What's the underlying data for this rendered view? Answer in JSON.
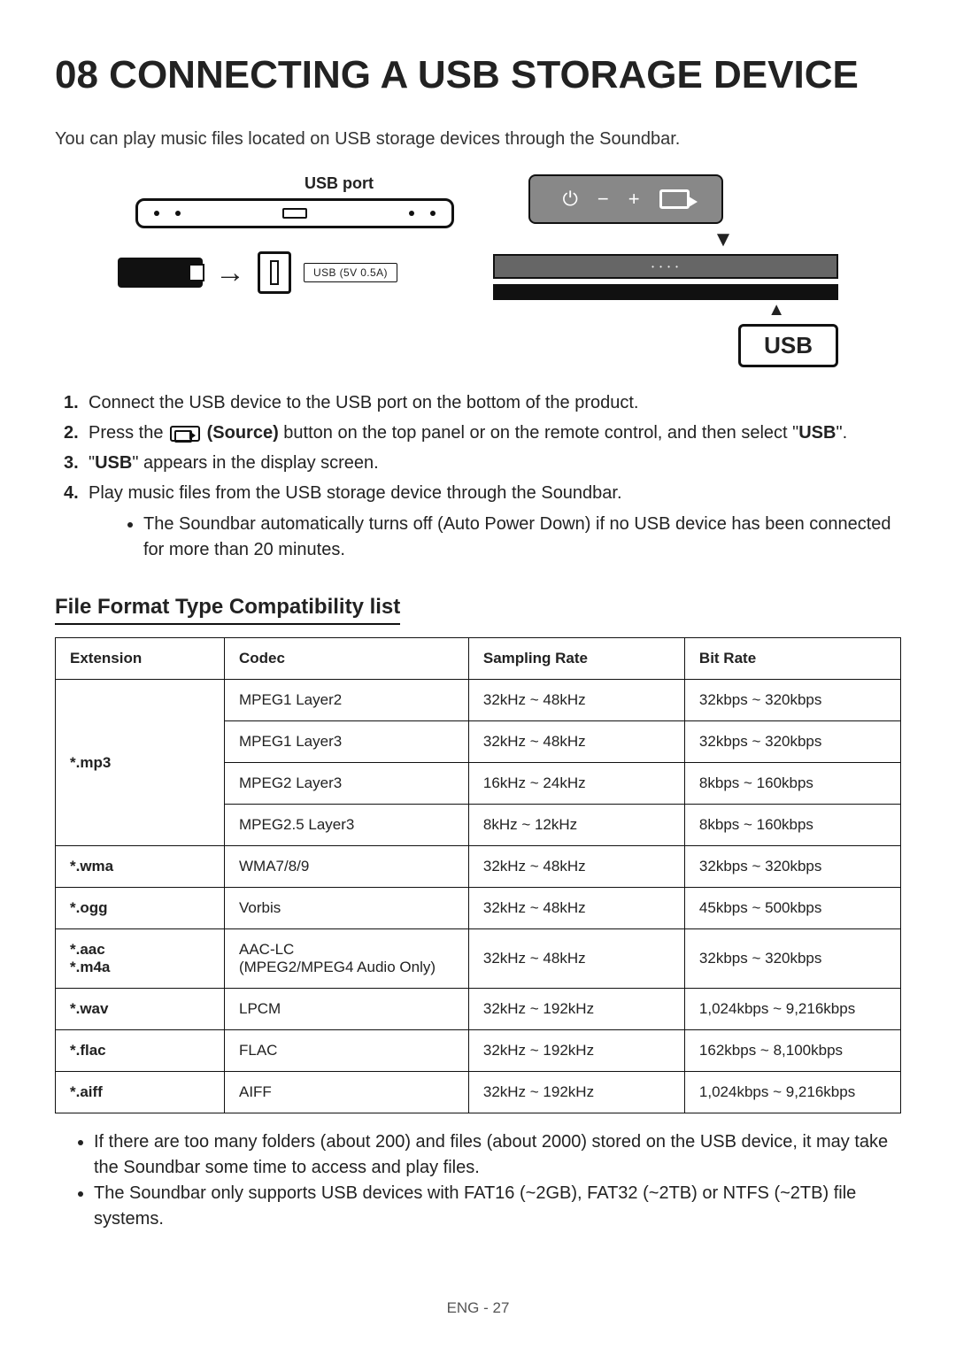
{
  "heading": "08  CONNECTING A USB STORAGE DEVICE",
  "intro": "You can play music files located on USB storage devices through the Soundbar.",
  "diagram": {
    "usb_port_label": "USB port",
    "usb_port_box": "USB (5V 0.5A)",
    "usb_badge": "USB"
  },
  "steps": {
    "s1": "Connect the USB device to the USB port on the bottom of the product.",
    "s2_a": "Press the ",
    "s2_b": " (Source)",
    "s2_c": " button on the top panel or on the remote control, and then select \"",
    "s2_d": "USB",
    "s2_e": "\".",
    "s3_a": "\"",
    "s3_b": "USB",
    "s3_c": "\" appears in the display screen.",
    "s4": "Play music files from the USB storage device through the Soundbar.",
    "s4_bullet": "The Soundbar automatically turns off (Auto Power Down) if no USB device has been connected for more than 20 minutes."
  },
  "subheading": "File Format Type Compatibility list",
  "table": {
    "headers": {
      "ext": "Extension",
      "codec": "Codec",
      "sample": "Sampling Rate",
      "bit": "Bit Rate"
    },
    "rows": [
      {
        "ext": "*.mp3",
        "codec": "MPEG1 Layer2",
        "sample": "32kHz ~ 48kHz",
        "bit": "32kbps ~ 320kbps",
        "rowspan": 4
      },
      {
        "ext": "",
        "codec": "MPEG1 Layer3",
        "sample": "32kHz ~ 48kHz",
        "bit": "32kbps ~ 320kbps"
      },
      {
        "ext": "",
        "codec": "MPEG2 Layer3",
        "sample": "16kHz ~ 24kHz",
        "bit": "8kbps ~ 160kbps"
      },
      {
        "ext": "",
        "codec": "MPEG2.5 Layer3",
        "sample": "8kHz ~ 12kHz",
        "bit": "8kbps ~ 160kbps"
      },
      {
        "ext": "*.wma",
        "codec": "WMA7/8/9",
        "sample": "32kHz ~ 48kHz",
        "bit": "32kbps ~ 320kbps"
      },
      {
        "ext": "*.ogg",
        "codec": "Vorbis",
        "sample": "32kHz ~ 48kHz",
        "bit": "45kbps ~ 500kbps"
      },
      {
        "ext": "*.aac\n*.m4a",
        "codec": "AAC-LC\n(MPEG2/MPEG4 Audio Only)",
        "sample": "32kHz ~ 48kHz",
        "bit": "32kbps ~ 320kbps"
      },
      {
        "ext": "*.wav",
        "codec": "LPCM",
        "sample": "32kHz ~ 192kHz",
        "bit": "1,024kbps ~ 9,216kbps"
      },
      {
        "ext": "*.flac",
        "codec": "FLAC",
        "sample": "32kHz ~ 192kHz",
        "bit": "162kbps ~ 8,100kbps"
      },
      {
        "ext": "*.aiff",
        "codec": "AIFF",
        "sample": "32kHz ~ 192kHz",
        "bit": "1,024kbps ~ 9,216kbps"
      }
    ]
  },
  "notes": [
    "If there are too many folders (about 200) and files (about 2000) stored on the USB device, it may take the Soundbar some time to access and play files.",
    "The Soundbar only supports USB devices with FAT16 (~2GB), FAT32 (~2TB) or NTFS (~2TB) file systems."
  ],
  "footer": "ENG - 27"
}
